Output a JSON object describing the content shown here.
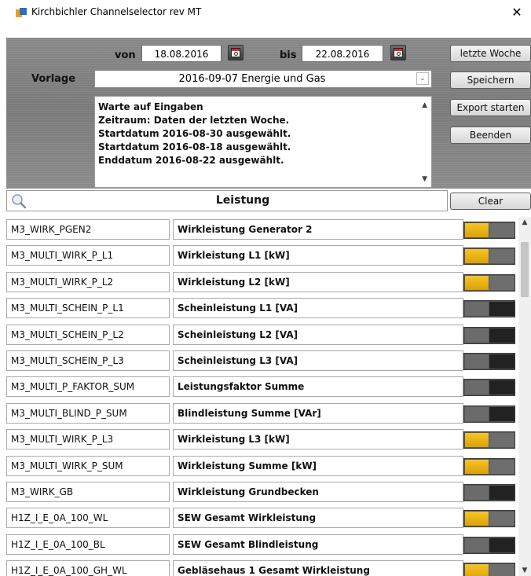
{
  "window": {
    "title": "Kirchbichler Channelselector rev MT",
    "close": "✕"
  },
  "date_range": {
    "from_label": "von",
    "from_value": "18.08.2016",
    "to_label": "bis",
    "to_value": "22.08.2016"
  },
  "template": {
    "label": "Vorlage",
    "value": "2016-09-07 Energie und Gas",
    "dropdown_glyph": "⌄"
  },
  "buttons": {
    "last_week": "letzte Woche",
    "save": "Speichern",
    "export": "Export starten",
    "quit": "Beenden",
    "clear": "Clear"
  },
  "log": {
    "lines": [
      "Warte auf Eingaben",
      "Zeitraum: Daten der letzten Woche.",
      "Startdatum 2016-08-30 ausgewählt.",
      "Startdatum 2016-08-18 ausgewählt.",
      "Enddatum 2016-08-22 ausgewählt."
    ],
    "scroll_up": "▲",
    "scroll_down": "▼"
  },
  "search": {
    "value": "Leistung"
  },
  "channels": [
    {
      "code": "M3_WIRK_PGEN2",
      "description": "Wirkleistung Generator 2",
      "selected": true
    },
    {
      "code": "M3_MULTI_WIRK_P_L1",
      "description": "Wirkleistung L1 [kW]",
      "selected": true
    },
    {
      "code": "M3_MULTI_WIRK_P_L2",
      "description": "Wirkleistung L2 [kW]",
      "selected": true
    },
    {
      "code": "M3_MULTI_SCHEIN_P_L1",
      "description": "Scheinleistung L1 [VA]",
      "selected": false
    },
    {
      "code": "M3_MULTI_SCHEIN_P_L2",
      "description": "Scheinleistung L2 [VA]",
      "selected": false
    },
    {
      "code": "M3_MULTI_SCHEIN_P_L3",
      "description": "Scheinleistung L3 [VA]",
      "selected": false
    },
    {
      "code": "M3_MULTI_P_FAKTOR_SUM",
      "description": "Leistungsfaktor Summe",
      "selected": false
    },
    {
      "code": "M3_MULTI_BLIND_P_SUM",
      "description": "Blindleistung Summe [VAr]",
      "selected": false
    },
    {
      "code": "M3_MULTI_WIRK_P_L3",
      "description": "Wirkleistung L3 [kW]",
      "selected": true
    },
    {
      "code": "M3_MULTI_WIRK_P_SUM",
      "description": "Wirkleistung Summe [kW]",
      "selected": true
    },
    {
      "code": "M3_WIRK_GB",
      "description": "Wirkleistung Grundbecken",
      "selected": false
    },
    {
      "code": "H1Z_I_E_0A_100_WL",
      "description": "SEW Gesamt Wirkleistung",
      "selected": true
    },
    {
      "code": "H1Z_I_E_0A_100_BL",
      "description": "SEW Gesamt Blindleistung",
      "selected": false
    },
    {
      "code": "H1Z_I_E_0A_100_GH_WL",
      "description": "Gebläsehaus 1 Gesamt Wirkleistung",
      "selected": true
    }
  ],
  "scrollbar": {
    "up": "▲",
    "down": "▼"
  },
  "colors": {
    "toggle_on": "#f2b90f",
    "toggle_off": "#222222",
    "panel": "#808080"
  }
}
